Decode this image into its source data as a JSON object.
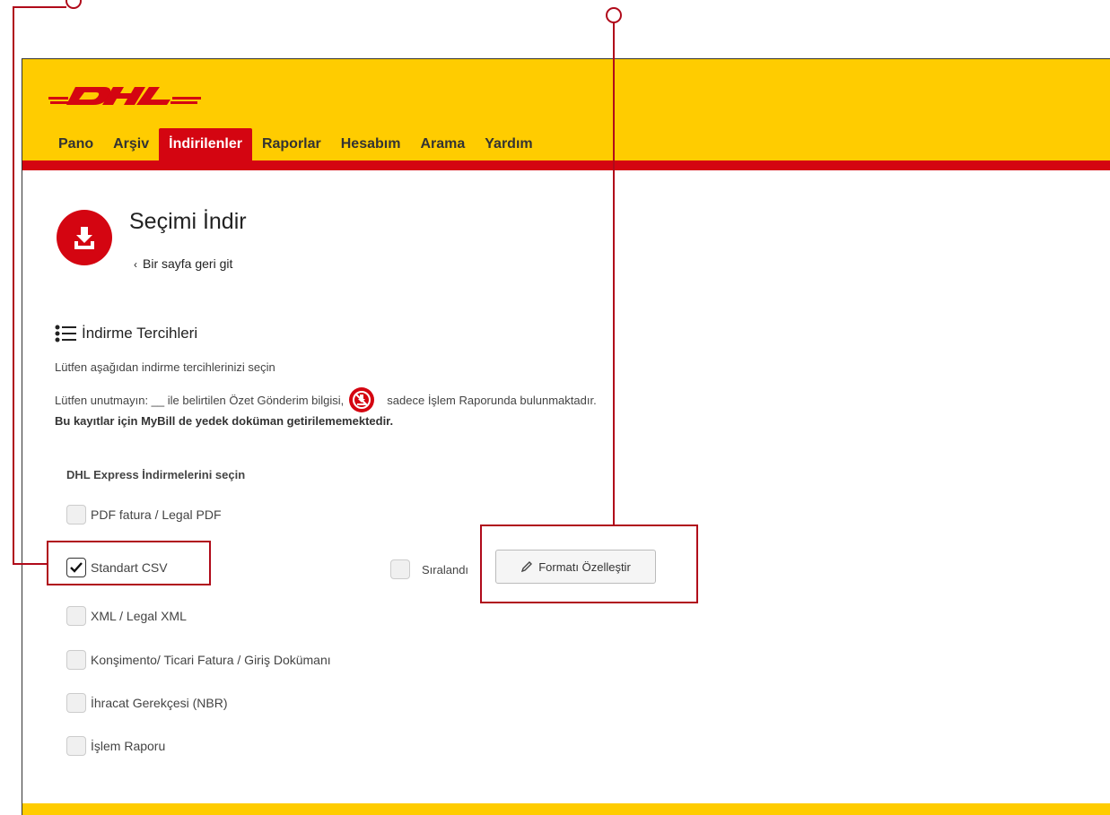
{
  "brand": {
    "logo_text": "DHL",
    "yellow": "#ffcc00",
    "red": "#d40511"
  },
  "nav": {
    "items": [
      {
        "label": "Pano",
        "active": false
      },
      {
        "label": "Arşiv",
        "active": false
      },
      {
        "label": "İndirilenler",
        "active": true
      },
      {
        "label": "Raporlar",
        "active": false
      },
      {
        "label": "Hesabım",
        "active": false
      },
      {
        "label": "Arama",
        "active": false
      },
      {
        "label": "Yardım",
        "active": false
      }
    ]
  },
  "page": {
    "icon": "download-icon",
    "title": "Seçimi İndir",
    "back_label": "Bir sayfa geri git"
  },
  "preferences": {
    "icon": "list-icon",
    "heading": "İndirme Tercihleri",
    "line1": "Lütfen aşağıdan indirme tercihlerinizi seçin",
    "line2_before": "Lütfen unutmayın: __ ile belirtilen Özet Gönderim bilgisi,",
    "line2_icon": "no-download-icon",
    "line2_after": "sadece İşlem Raporunda bulunmaktadır.",
    "line3": "Bu kayıtlar için MyBill de yedek doküman getirilememektedir."
  },
  "downloads": {
    "heading": "DHL Express İndirmelerini seçin",
    "options": [
      {
        "label": "PDF fatura / Legal PDF",
        "checked": false
      },
      {
        "label": "Standart CSV",
        "checked": true
      },
      {
        "label": "XML / Legal XML",
        "checked": false
      },
      {
        "label": "Konşimento/ Ticari Fatura / Giriş Dokümanı",
        "checked": false
      },
      {
        "label": "İhracat Gerekçesi (NBR)",
        "checked": false
      },
      {
        "label": "İşlem Raporu",
        "checked": false
      }
    ],
    "sorted": {
      "label": "Sıralandı",
      "checked": false
    },
    "customize_label": "Formatı Özelleştir",
    "customize_icon": "pencil-icon"
  },
  "annotation_color": "#b00a1a"
}
